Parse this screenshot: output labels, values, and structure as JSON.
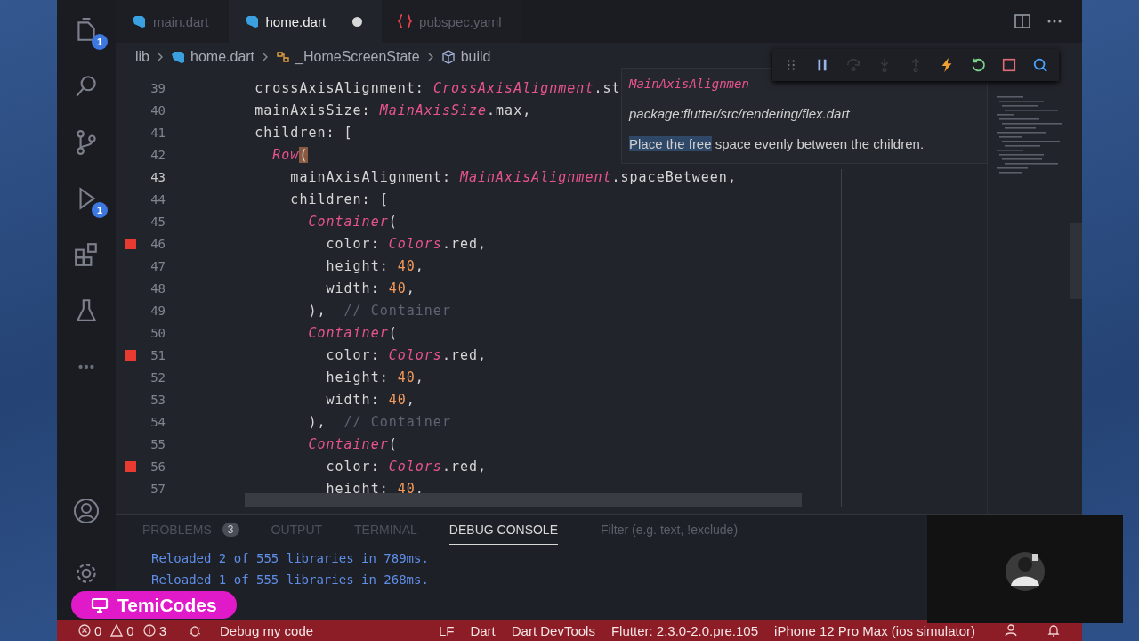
{
  "activity_bar": {
    "items": [
      {
        "kind": "files",
        "badge": "1"
      },
      {
        "kind": "search"
      },
      {
        "kind": "source-control"
      },
      {
        "kind": "run",
        "badge": "1"
      },
      {
        "kind": "extensions"
      },
      {
        "kind": "testing"
      },
      {
        "kind": "more"
      }
    ],
    "bottom": [
      {
        "kind": "account"
      },
      {
        "kind": "settings"
      }
    ]
  },
  "tabs": [
    {
      "label": "main.dart",
      "kind": "dart",
      "selected": false,
      "dirty": false
    },
    {
      "label": "home.dart",
      "kind": "dart",
      "selected": true,
      "dirty": true
    },
    {
      "label": "pubspec.yaml",
      "kind": "yaml",
      "selected": false,
      "dirty": false
    }
  ],
  "breadcrumb": [
    {
      "label": "lib",
      "kind": "folder"
    },
    {
      "label": "home.dart",
      "kind": "dart"
    },
    {
      "label": "_HomeScreenState",
      "kind": "class"
    },
    {
      "label": "build",
      "kind": "method"
    }
  ],
  "editor": {
    "lines": [
      {
        "number": "39",
        "current": false,
        "breakpoint": false,
        "tokens": [
          {
            "kind": "plain",
            "text": "        crossAxisAlignment: "
          },
          {
            "kind": "type",
            "text": "CrossAxisAlignment"
          },
          {
            "kind": "plain",
            "text": ".st"
          }
        ]
      },
      {
        "number": "40",
        "current": false,
        "breakpoint": false,
        "tokens": [
          {
            "kind": "plain",
            "text": "        mainAxisSize: "
          },
          {
            "kind": "type",
            "text": "MainAxisSize"
          },
          {
            "kind": "plain",
            "text": ".max,"
          }
        ]
      },
      {
        "number": "41",
        "current": false,
        "breakpoint": false,
        "tokens": [
          {
            "kind": "plain",
            "text": "        children: ["
          }
        ]
      },
      {
        "number": "42",
        "current": false,
        "breakpoint": false,
        "tokens": [
          {
            "kind": "type",
            "text": "          Row"
          },
          {
            "kind": "match",
            "text": "("
          }
        ]
      },
      {
        "number": "43",
        "current": true,
        "breakpoint": false,
        "tokens": [
          {
            "kind": "plain",
            "text": "            mainAxisAlignment: "
          },
          {
            "kind": "type",
            "text": "MainAxisAlignment"
          },
          {
            "kind": "plain",
            "text": ".spaceBetween,"
          }
        ]
      },
      {
        "number": "44",
        "current": false,
        "breakpoint": false,
        "tokens": [
          {
            "kind": "plain",
            "text": "            children: ["
          }
        ]
      },
      {
        "number": "45",
        "current": false,
        "breakpoint": false,
        "tokens": [
          {
            "kind": "type",
            "text": "              Container"
          },
          {
            "kind": "plain",
            "text": "("
          }
        ]
      },
      {
        "number": "46",
        "current": false,
        "breakpoint": true,
        "tokens": [
          {
            "kind": "plain",
            "text": "                color: "
          },
          {
            "kind": "type",
            "text": "Colors"
          },
          {
            "kind": "plain",
            "text": ".red,"
          }
        ]
      },
      {
        "number": "47",
        "current": false,
        "breakpoint": false,
        "tokens": [
          {
            "kind": "plain",
            "text": "                height: "
          },
          {
            "kind": "number",
            "text": "40"
          },
          {
            "kind": "plain",
            "text": ","
          }
        ]
      },
      {
        "number": "48",
        "current": false,
        "breakpoint": false,
        "tokens": [
          {
            "kind": "plain",
            "text": "                width: "
          },
          {
            "kind": "number",
            "text": "40"
          },
          {
            "kind": "plain",
            "text": ","
          }
        ]
      },
      {
        "number": "49",
        "current": false,
        "breakpoint": false,
        "tokens": [
          {
            "kind": "plain",
            "text": "              ),  "
          },
          {
            "kind": "comment",
            "text": "// Container"
          }
        ]
      },
      {
        "number": "50",
        "current": false,
        "breakpoint": false,
        "tokens": [
          {
            "kind": "type",
            "text": "              Container"
          },
          {
            "kind": "plain",
            "text": "("
          }
        ]
      },
      {
        "number": "51",
        "current": false,
        "breakpoint": true,
        "tokens": [
          {
            "kind": "plain",
            "text": "                color: "
          },
          {
            "kind": "type",
            "text": "Colors"
          },
          {
            "kind": "plain",
            "text": ".red,"
          }
        ]
      },
      {
        "number": "52",
        "current": false,
        "breakpoint": false,
        "tokens": [
          {
            "kind": "plain",
            "text": "                height: "
          },
          {
            "kind": "number",
            "text": "40"
          },
          {
            "kind": "plain",
            "text": ","
          }
        ]
      },
      {
        "number": "53",
        "current": false,
        "breakpoint": false,
        "tokens": [
          {
            "kind": "plain",
            "text": "                width: "
          },
          {
            "kind": "number",
            "text": "40"
          },
          {
            "kind": "plain",
            "text": ","
          }
        ]
      },
      {
        "number": "54",
        "current": false,
        "breakpoint": false,
        "tokens": [
          {
            "kind": "plain",
            "text": "              ),  "
          },
          {
            "kind": "comment",
            "text": "// Container"
          }
        ]
      },
      {
        "number": "55",
        "current": false,
        "breakpoint": false,
        "tokens": [
          {
            "kind": "type",
            "text": "              Container"
          },
          {
            "kind": "plain",
            "text": "("
          }
        ]
      },
      {
        "number": "56",
        "current": false,
        "breakpoint": true,
        "tokens": [
          {
            "kind": "plain",
            "text": "                color: "
          },
          {
            "kind": "type",
            "text": "Colors"
          },
          {
            "kind": "plain",
            "text": ".red,"
          }
        ]
      },
      {
        "number": "57",
        "current": false,
        "breakpoint": false,
        "tokens": [
          {
            "kind": "plain",
            "text": "                height: "
          },
          {
            "kind": "number",
            "text": "40"
          },
          {
            "kind": "plain",
            "text": ","
          }
        ]
      }
    ]
  },
  "hover": {
    "signature": "MainAxisAlignmen",
    "path": "package:flutter/src/rendering/flex.dart",
    "doc": [
      {
        "text": "Place the free",
        "selected": true
      },
      {
        "text": " space evenly between the children.",
        "selected": false
      }
    ]
  },
  "debug_toolbar": [
    {
      "kind": "grip",
      "disabled": false
    },
    {
      "kind": "pause",
      "disabled": false
    },
    {
      "kind": "step-over",
      "disabled": true
    },
    {
      "kind": "step-into",
      "disabled": true
    },
    {
      "kind": "step-out",
      "disabled": true
    },
    {
      "kind": "hot-reload",
      "disabled": false
    },
    {
      "kind": "restart",
      "disabled": false
    },
    {
      "kind": "stop",
      "disabled": false
    },
    {
      "kind": "devtools",
      "disabled": false
    }
  ],
  "panel": {
    "tabs": [
      {
        "label": "PROBLEMS",
        "badge": "3",
        "selected": false
      },
      {
        "label": "OUTPUT",
        "selected": false
      },
      {
        "label": "TERMINAL",
        "selected": false
      },
      {
        "label": "DEBUG CONSOLE",
        "selected": true
      }
    ],
    "filter": {
      "placeholder": "Filter (e.g. text, !exclude)"
    },
    "console": [
      "Reloaded 2 of 555 libraries in 789ms.",
      "Reloaded 1 of 555 libraries in 268ms."
    ]
  },
  "status_bar": {
    "left": [
      {
        "kind": "error",
        "text": "0"
      },
      {
        "kind": "warning",
        "text": "0"
      },
      {
        "kind": "info",
        "text": "3"
      },
      {
        "kind": "debug",
        "text": "Debug my code"
      }
    ],
    "right": [
      "LF",
      "Dart",
      "Dart DevTools",
      "Flutter: 2.3.0-2.0.pre.105",
      "iPhone 12 Pro Max (ios simulator)"
    ]
  },
  "overlay": {
    "badge": "TemiCodes"
  }
}
